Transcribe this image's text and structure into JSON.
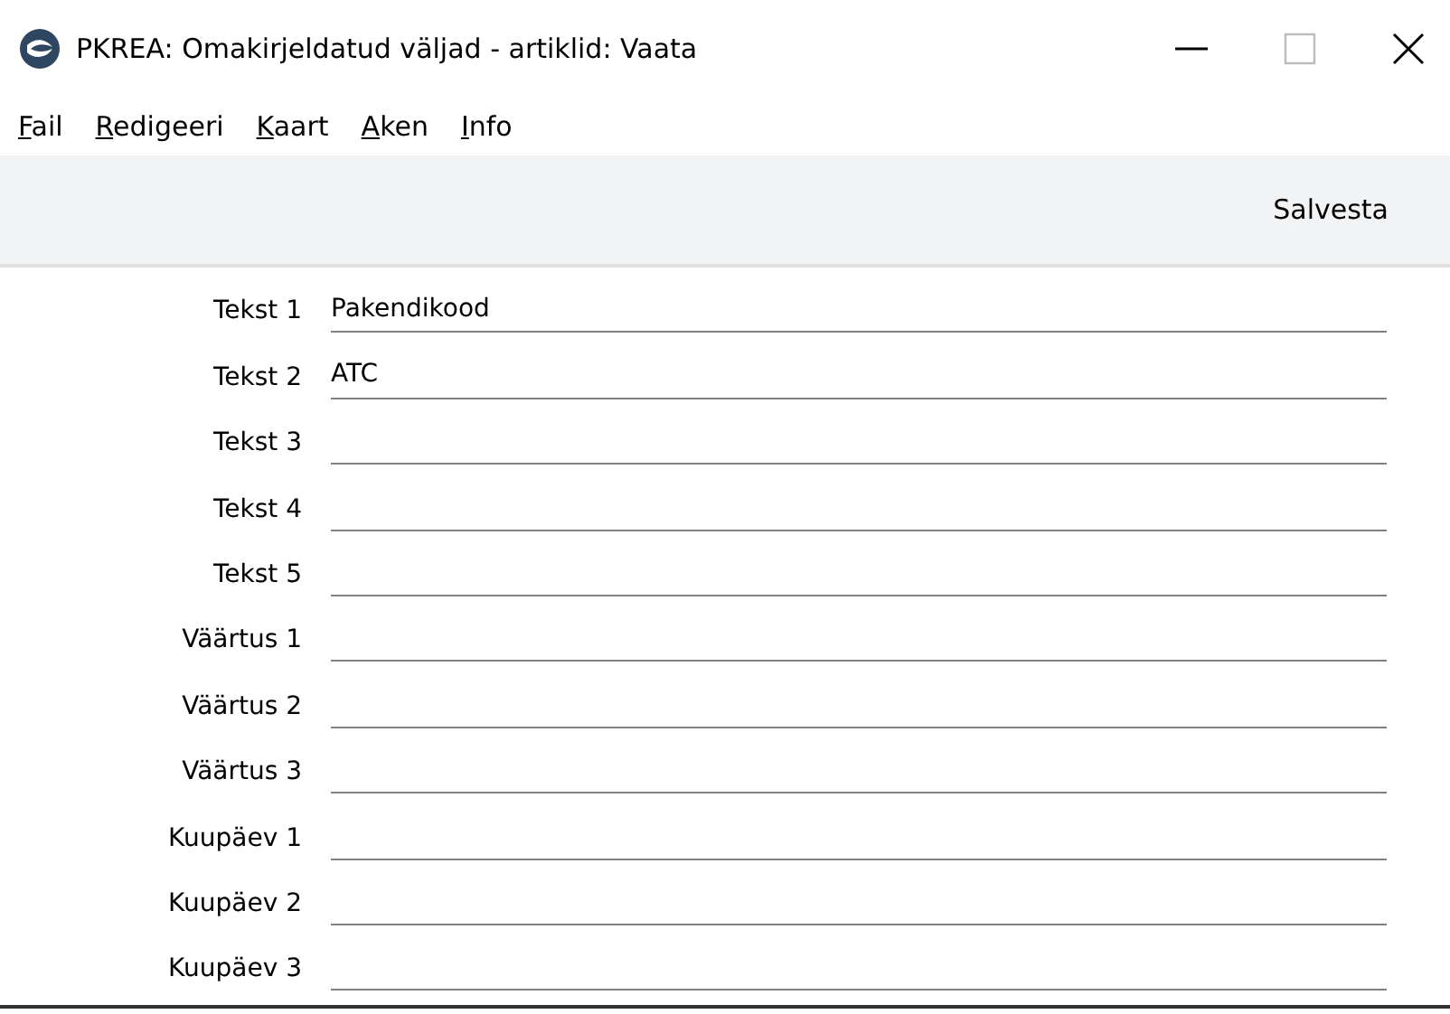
{
  "window": {
    "title": "PKREA: Omakirjeldatud väljad - artiklid: Vaata"
  },
  "menu": [
    "Fail",
    "Redigeeri",
    "Kaart",
    "Aken",
    "Info"
  ],
  "toolbar": {
    "save_button": "Salvesta"
  },
  "fields": [
    {
      "label": "Tekst 1",
      "value": "Pakendikood"
    },
    {
      "label": "Tekst 2",
      "value": "ATC"
    },
    {
      "label": "Tekst 3"
    },
    {
      "label": "Tekst 4"
    },
    {
      "label": "Tekst 5"
    },
    {
      "label": "Väärtus 1"
    },
    {
      "label": "Väärtus 2"
    },
    {
      "label": "Väärtus 3"
    },
    {
      "label": "Kuupäev 1"
    },
    {
      "label": "Kuupäev 2"
    },
    {
      "label": "Kuupäev 3"
    }
  ]
}
